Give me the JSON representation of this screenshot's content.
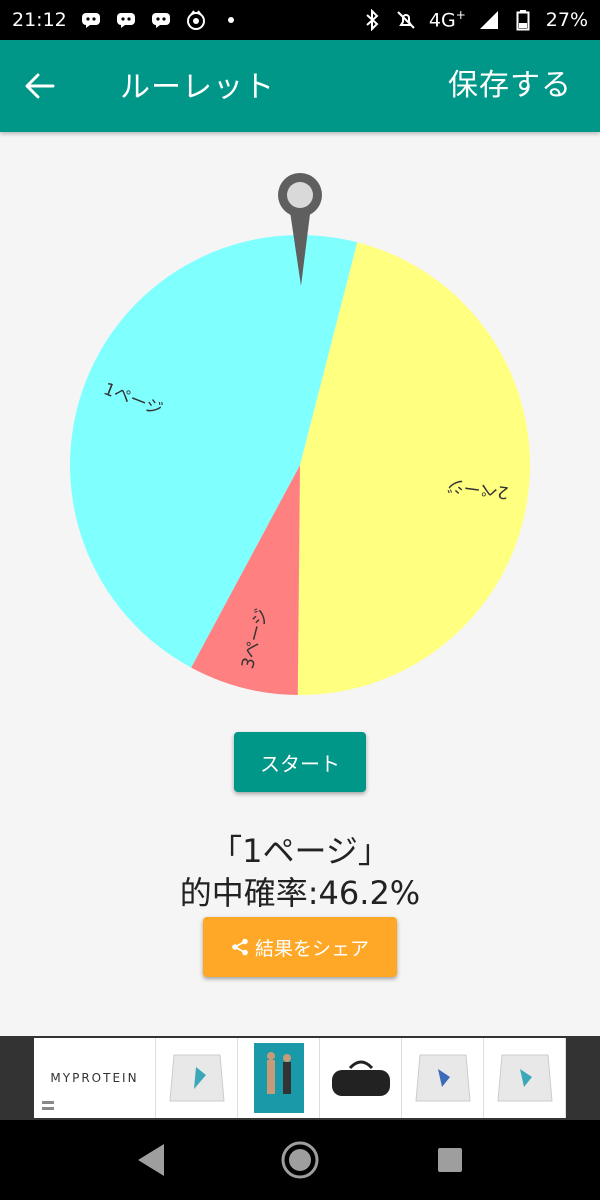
{
  "status_bar": {
    "time": "21:12",
    "network": "4G",
    "network_plus": "+",
    "battery": "27%"
  },
  "app_bar": {
    "title": "ルーレット",
    "save_label": "保存する"
  },
  "roulette": {
    "segments": [
      {
        "label": "1ページ",
        "color": "#80ffff",
        "share": 0.462
      },
      {
        "label": "2ページ",
        "color": "#ffff80",
        "share": 0.462
      },
      {
        "label": "3ページ",
        "color": "#ff8080",
        "share": 0.077
      }
    ]
  },
  "start_label": "スタート",
  "result": {
    "name": "「1ページ」",
    "rate": "的中確率:46.2%"
  },
  "share_label": "結果をシェア",
  "ad": {
    "brand": "MYPROTEIN"
  },
  "colors": {
    "primary": "#009688",
    "accent": "#ffa726"
  }
}
